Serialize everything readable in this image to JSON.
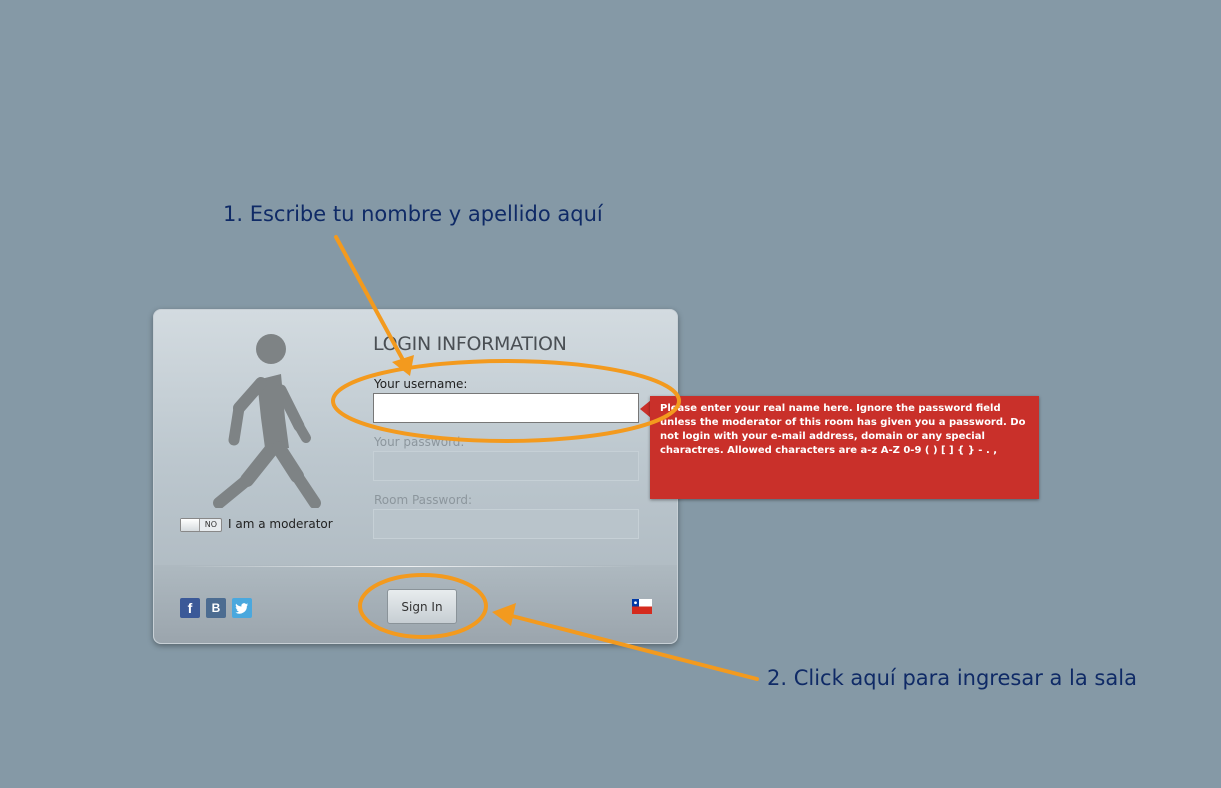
{
  "annotations": {
    "step1": "1. Escribe tu nombre y apellido aquí",
    "step2": "2. Click aquí para ingresar a la sala"
  },
  "login": {
    "title": "LOGIN INFORMATION",
    "username_label": "Your username:",
    "username_value": "",
    "password_label": "Your password:",
    "room_password_label": "Room Password:",
    "moderator_toggle": "NO",
    "moderator_label": "I am a moderator",
    "signin_label": "Sign In"
  },
  "social": {
    "facebook": "f",
    "vkontakte": "B",
    "twitter_icon": "twitter-bird-icon"
  },
  "tooltip": {
    "text": "Please enter your real name here. Ignore the password field unless the moderator of this room has given you a password. Do not login with your e-mail address, domain or any special charactres. Allowed characters are a-z A-Z 0-9 ( ) [ ] { } - . ,"
  },
  "colors": {
    "background": "#8599a6",
    "annotation_text": "#0f2a66",
    "highlight": "#f39a1e",
    "tooltip": "#c9302a"
  }
}
